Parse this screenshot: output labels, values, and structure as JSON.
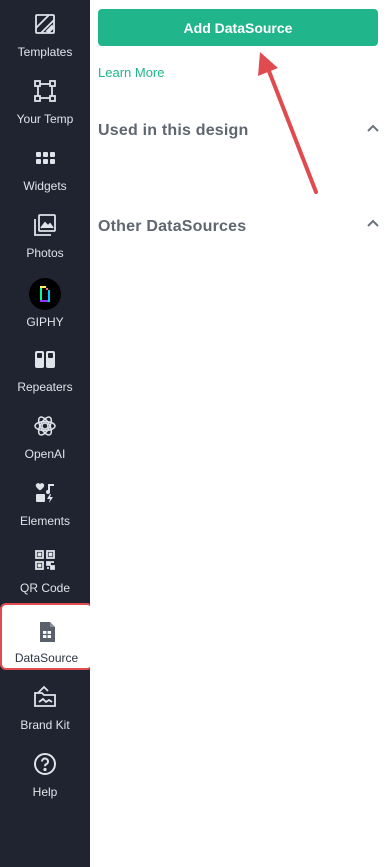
{
  "sidebar": {
    "items": [
      {
        "label": "Templates",
        "icon": "templates-icon"
      },
      {
        "label": "Your Temp",
        "icon": "your-templates-icon"
      },
      {
        "label": "Widgets",
        "icon": "widgets-icon"
      },
      {
        "label": "Photos",
        "icon": "photos-icon"
      },
      {
        "label": "GIPHY",
        "icon": "giphy-icon"
      },
      {
        "label": "Repeaters",
        "icon": "repeaters-icon"
      },
      {
        "label": "OpenAI",
        "icon": "openai-icon"
      },
      {
        "label": "Elements",
        "icon": "elements-icon"
      },
      {
        "label": "QR Code",
        "icon": "qr-code-icon"
      },
      {
        "label": "DataSource",
        "icon": "datasource-icon",
        "active": true
      },
      {
        "label": "Brand Kit",
        "icon": "brand-kit-icon"
      },
      {
        "label": "Help",
        "icon": "help-icon"
      }
    ]
  },
  "panel": {
    "add_button_label": "Add DataSource",
    "learn_more_label": "Learn More",
    "sections": [
      {
        "title": "Used in this design",
        "expanded": true
      },
      {
        "title": "Other DataSources",
        "expanded": true
      }
    ]
  },
  "colors": {
    "sidebar_bg": "#1f2430",
    "accent": "#20b58a",
    "highlight": "#e04b4f"
  }
}
